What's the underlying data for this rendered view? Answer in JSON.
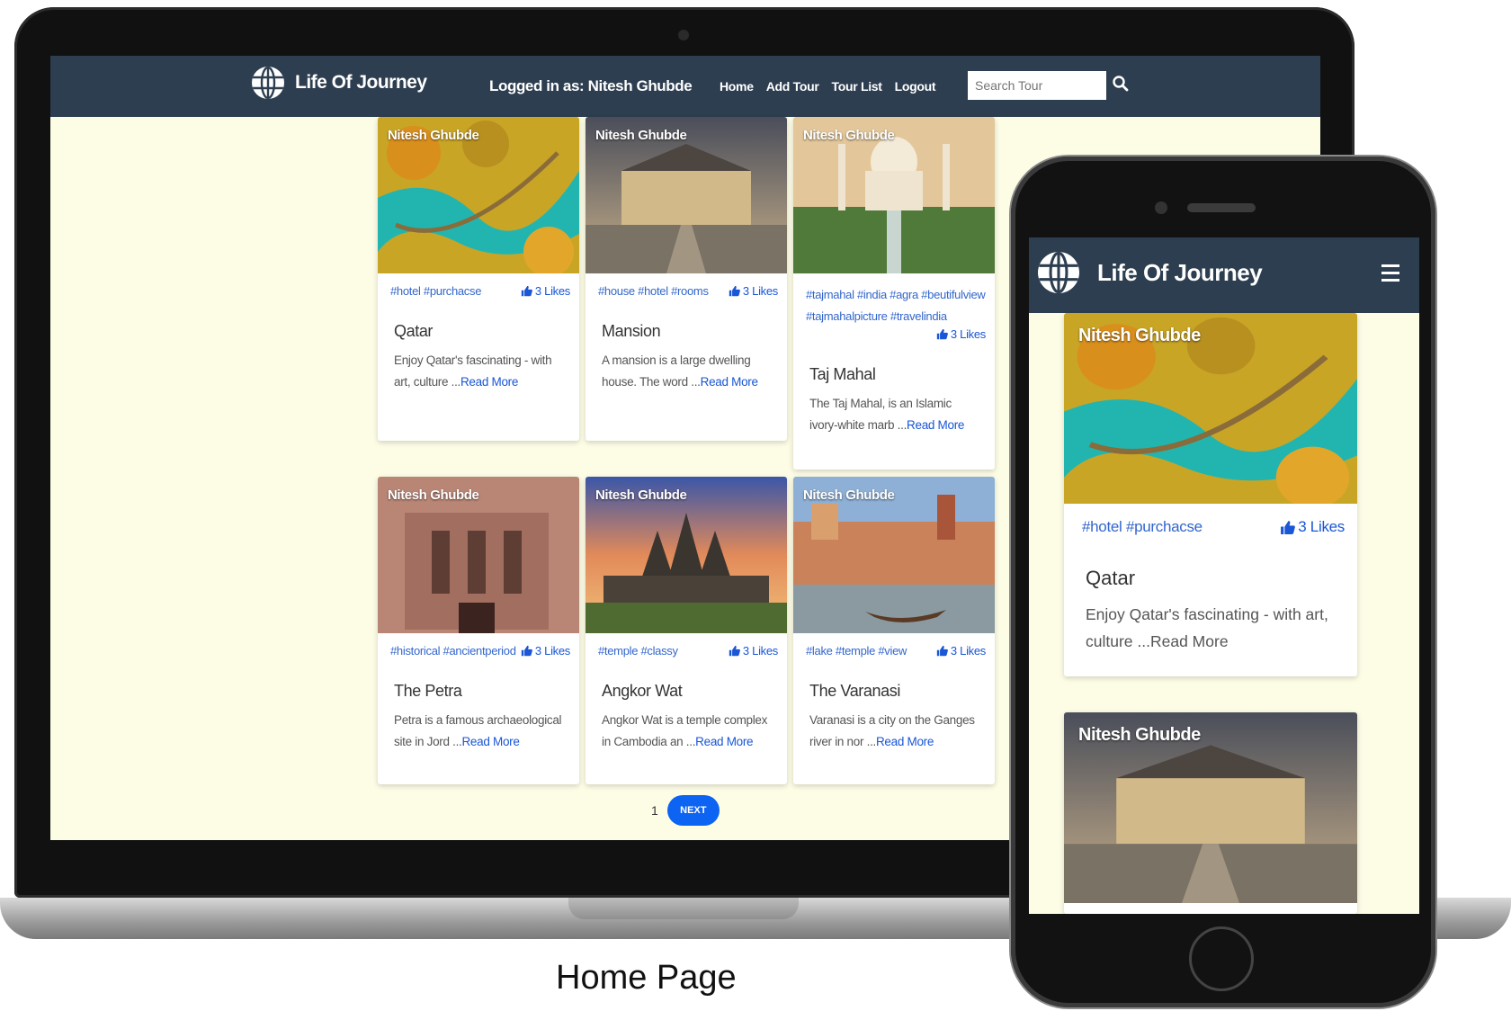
{
  "app": {
    "brand": "Life Of Journey"
  },
  "navbar": {
    "logged_in": "Logged in as: Nitesh Ghubde",
    "links": [
      "Home",
      "Add Tour",
      "Tour List",
      "Logout"
    ],
    "search_placeholder": "Search Tour"
  },
  "cards": [
    {
      "author": "Nitesh Ghubde",
      "tags": "#hotel #purchacse",
      "likes": "3 Likes",
      "title": "Qatar",
      "desc": "Enjoy Qatar's fascinating - with art, culture ...",
      "more": "Read More"
    },
    {
      "author": "Nitesh Ghubde",
      "tags": "#house #hotel #rooms",
      "likes": "3 Likes",
      "title": "Mansion",
      "desc": "A mansion is a large dwelling house. The word ...",
      "more": "Read More"
    },
    {
      "author": "Nitesh Ghubde",
      "tags": "#tajmahal #india #agra #beutifulview #tajmahalpicture #travelindia",
      "likes": "3 Likes",
      "title": "Taj Mahal",
      "desc": "The Taj Mahal, is an Islamic ivory-white marb ...",
      "more": "Read More"
    },
    {
      "author": "Nitesh Ghubde",
      "tags": "#historical #ancientperiod",
      "likes": "3 Likes",
      "title": "The Petra",
      "desc": "Petra is a famous archaeological site in Jord ...",
      "more": "Read More"
    },
    {
      "author": "Nitesh Ghubde",
      "tags": "#temple #classy",
      "likes": "3 Likes",
      "title": "Angkor Wat",
      "desc": "Angkor Wat is a temple complex in Cambodia an ...",
      "more": "Read More"
    },
    {
      "author": "Nitesh Ghubde",
      "tags": "#lake #temple #view",
      "likes": "3 Likes",
      "title": "The Varanasi",
      "desc": "Varanasi is a city on the Ganges river in nor ...",
      "more": "Read More"
    }
  ],
  "pagination": {
    "page": "1",
    "next": "NEXT"
  },
  "caption": "Home Page",
  "mobile": {
    "brand": "Life Of Journey",
    "card": {
      "author": "Nitesh Ghubde",
      "tags": "#hotel #purchacse",
      "likes": "3 Likes",
      "title": "Qatar",
      "desc": "Enjoy Qatar's fascinating - with art, culture ...",
      "more": "Read More"
    },
    "card2_author": "Nitesh Ghubde"
  },
  "colors": {
    "navbar": "#2d3e50",
    "page_bg": "#fdfde6",
    "link": "#1a56d6",
    "next_button": "#0d63f2"
  },
  "icons": [
    "globe-icon",
    "search-icon",
    "thumbs-up-icon",
    "hamburger-menu-icon"
  ]
}
